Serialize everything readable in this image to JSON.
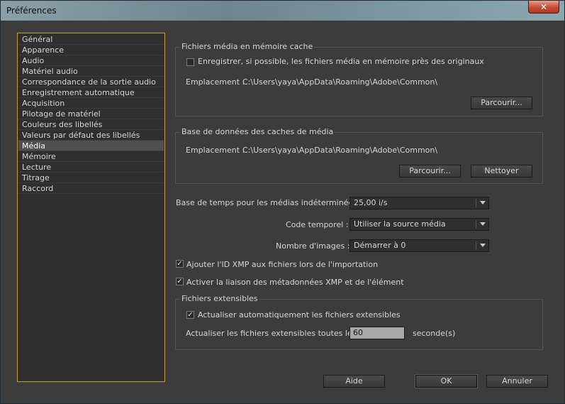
{
  "window": {
    "title": "Préférences",
    "close_glyph": "✕"
  },
  "sidebar": {
    "items": [
      {
        "label": "Général"
      },
      {
        "label": "Apparence"
      },
      {
        "label": "Audio"
      },
      {
        "label": "Matériel audio"
      },
      {
        "label": "Correspondance de la sortie audio"
      },
      {
        "label": "Enregistrement automatique"
      },
      {
        "label": "Acquisition"
      },
      {
        "label": "Pilotage de matériel"
      },
      {
        "label": "Couleurs des libellés"
      },
      {
        "label": "Valeurs par défaut des libellés"
      },
      {
        "label": "Média"
      },
      {
        "label": "Mémoire"
      },
      {
        "label": "Lecture"
      },
      {
        "label": "Titrage"
      },
      {
        "label": "Raccord"
      }
    ],
    "selected": "Média"
  },
  "cache_group": {
    "title": "Fichiers média en mémoire cache",
    "save_near_originals_label": "Enregistrer, si possible, les fichiers média en mémoire près des originaux",
    "save_near_originals_checked": false,
    "location_label": "Emplacement :",
    "location_value": "C:\\Users\\yaya\\AppData\\Roaming\\Adobe\\Common\\",
    "browse_label": "Parcourir..."
  },
  "db_group": {
    "title": "Base de données des caches de média",
    "location_label": "Emplacement :",
    "location_value": "C:\\Users\\yaya\\AppData\\Roaming\\Adobe\\Common\\",
    "browse_label": "Parcourir...",
    "clean_label": "Nettoyer"
  },
  "settings": {
    "timebase_label": "Base de temps pour les médias indéterminée :",
    "timebase_value": "25,00 i/s",
    "timecode_label": "Code temporel :",
    "timecode_value": "Utiliser la source média",
    "frame_count_label": "Nombre d'images :",
    "frame_count_value": "Démarrer à 0",
    "xmp_id_label": "Ajouter l'ID XMP aux fichiers lors de l'importation",
    "xmp_id_checked": true,
    "xmp_link_label": "Activer la liaison des métadonnées XMP et de l'élément",
    "xmp_link_checked": true
  },
  "growing_group": {
    "title": "Fichiers extensibles",
    "auto_refresh_label": "Actualiser automatiquement les fichiers extensibles",
    "auto_refresh_checked": true,
    "refresh_every_label": "Actualiser les fichiers extensibles toutes les",
    "refresh_every_value": "60",
    "unit_label": "seconde(s)"
  },
  "footer": {
    "help_label": "Aide",
    "ok_label": "OK",
    "cancel_label": "Annuler"
  },
  "glyphs": {
    "check": "✓"
  }
}
